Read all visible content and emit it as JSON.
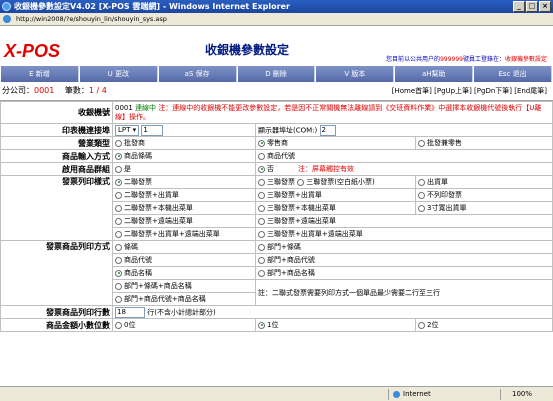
{
  "window": {
    "title": "收銀機參數設定V4.02 [X-POS 雲端網] - Windows Internet Explorer",
    "url": "http://win2008/?e/shouyin_lin/shouyin_sys.asp"
  },
  "header": {
    "logo": "X-POS",
    "page_title": "收銀機參數設定",
    "user_prefix": "您目前以公共用户的",
    "user_id": "999999",
    "user_mid": "號員工登錄在：",
    "user_suffix": "收銀機參數設定"
  },
  "toolbar": [
    "E 新增",
    "U 更改",
    "aS 保存",
    "D 刪除",
    "V 版本",
    "aH幫助",
    "Esc 退出"
  ],
  "info": {
    "branch_label": "分公司：",
    "branch_value": "0001",
    "count_label": "筆數：",
    "count_value": "1 / 4",
    "nav": "[Home首筆] [PgUp上筆] [PgDn下筆] [End尾筆]"
  },
  "rows": {
    "register_label": "收銀機號",
    "register_no": "0001",
    "register_status": "連線中",
    "register_note": "注：連線中的收銀機不能更改參數設定，若是因不正常關機無法離線請到《交班資料作業》中選擇本收銀機代號後執行【U離線】操作。",
    "printer_label": "印表機連接埠",
    "printer_port": "LPT",
    "printer_port_no": "1",
    "display_label": "顯示器埠址(COM:)",
    "display_port": "2",
    "business_label": "營業類型",
    "business_opts": [
      "批發商",
      "零售商",
      "批發兼零售"
    ],
    "input_label": "商品輸入方式",
    "input_opts": [
      "商品條碼",
      "商品代號"
    ],
    "group_label": "啟用商品群組",
    "group_opts": [
      "是",
      "否"
    ],
    "group_note": "注：屏幕觸控有效",
    "invoice_label": "發票列印樣式",
    "invoice_opts": [
      [
        "二聯發票",
        "三聯發票",
        "三聯發票(空白紙小票)",
        "出貨單"
      ],
      [
        "二聯發票+出貨單",
        "三聯發票+出貨單",
        "不列印發票"
      ],
      [
        "二聯發票+本機出菜單",
        "三聯發票+本機出菜單",
        "3寸寬出貨單"
      ],
      [
        "二聯發票+遠端出菜單",
        "三聯發票+遠端出菜單"
      ],
      [
        "二聯發票+出貨單+遠端出菜單",
        "三聯發票+出貨單+遠端出菜單"
      ]
    ],
    "item_print_label": "發票商品列印方式",
    "item_print_opts": [
      [
        "條碼",
        "部門+條碼"
      ],
      [
        "商品代號",
        "部門+商品代號"
      ],
      [
        "商品名稱",
        "部門+商品名稱"
      ],
      [
        "部門+條碼+商品名稱"
      ],
      [
        "部門+商品代號+商品名稱"
      ]
    ],
    "item_print_note": "註：二聯式發票需要列印方式一個單品最少需要二行至三行",
    "lines_label": "發票商品列印行數",
    "lines_value": "18",
    "lines_note": "行(不含小計總計部分)",
    "decimal_label": "商品金額小數位數",
    "decimal_opts": [
      "0位",
      "1位",
      "2位"
    ]
  },
  "status": {
    "zone": "Internet",
    "zoom": "100%"
  }
}
